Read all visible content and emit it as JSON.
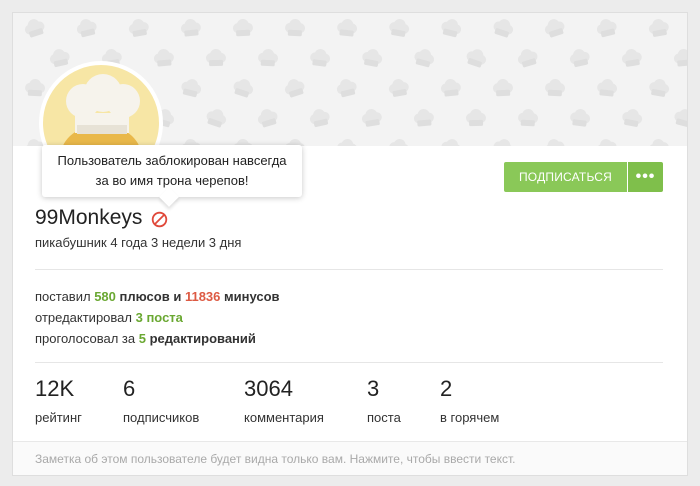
{
  "tooltip": {
    "line1": "Пользователь заблокирован навсегда",
    "line2": "за во имя трона черепов!"
  },
  "actions": {
    "subscribe_label": "ПОДПИСАТЬСЯ",
    "more_label": "•••"
  },
  "user": {
    "name": "99Monkeys",
    "duration": "пикабушник 4 года 3 недели 3 дня"
  },
  "stats": {
    "line1": {
      "prefix": "поставил",
      "pluses": "580",
      "mid": "плюсов и",
      "minuses": "11836",
      "suffix": "минусов"
    },
    "line2": {
      "prefix": "отредактировал",
      "value": "3 поста"
    },
    "line3": {
      "prefix": "проголосовал за",
      "value": "5",
      "suffix": "редактирований"
    }
  },
  "counters": [
    {
      "value": "12K",
      "label": "рейтинг"
    },
    {
      "value": "6",
      "label": "подписчиков"
    },
    {
      "value": "3064",
      "label": "комментария"
    },
    {
      "value": "3",
      "label": "поста"
    },
    {
      "value": "2",
      "label": "в горячем"
    }
  ],
  "note": {
    "placeholder": "Заметка об этом пользователе будет видна только вам. Нажмите, чтобы ввести текст."
  },
  "colors": {
    "accent_green": "#8ac858",
    "plus_green": "#6aa832",
    "minus_red": "#dd5a43",
    "ban_red": "#e0493a"
  },
  "icons": {
    "ban": "ban-icon",
    "more": "more-dots-icon",
    "avatar": "chef-hat-avatar"
  }
}
